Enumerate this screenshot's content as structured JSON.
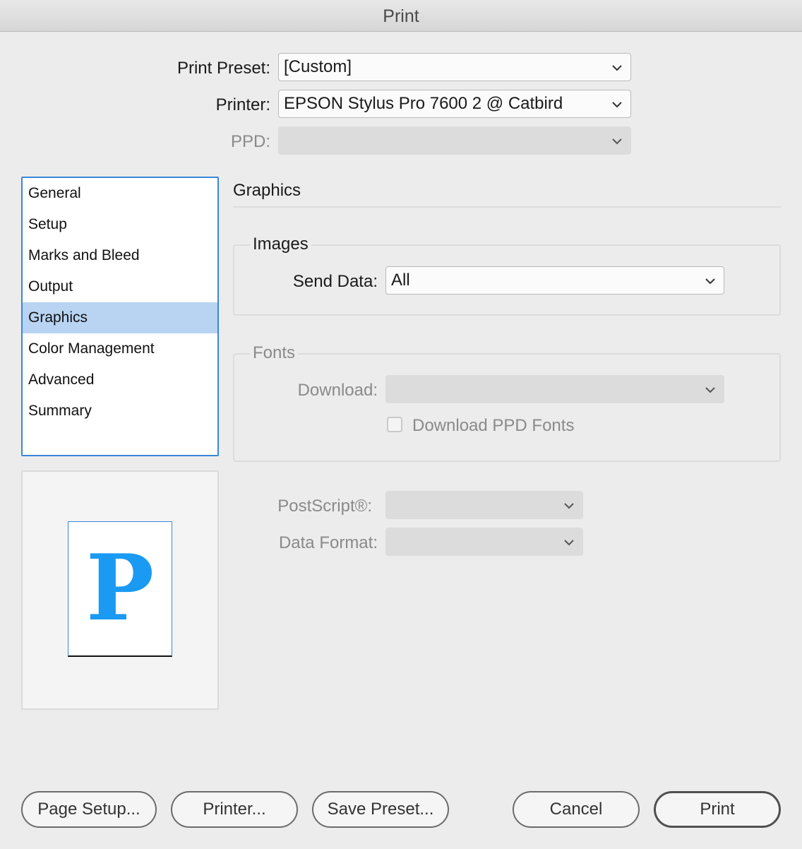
{
  "window": {
    "title": "Print"
  },
  "header": {
    "preset_label": "Print Preset:",
    "preset_value": "[Custom]",
    "printer_label": "Printer:",
    "printer_value": "EPSON Stylus Pro 7600 2 @ Catbird",
    "ppd_label": "PPD:",
    "ppd_value": ""
  },
  "sidebar": {
    "items": [
      {
        "label": "General"
      },
      {
        "label": "Setup"
      },
      {
        "label": "Marks and Bleed"
      },
      {
        "label": "Output"
      },
      {
        "label": "Graphics",
        "selected": true
      },
      {
        "label": "Color Management"
      },
      {
        "label": "Advanced"
      },
      {
        "label": "Summary"
      }
    ]
  },
  "preview": {
    "glyph": "P",
    "glyph_color": "#1a9af2"
  },
  "main": {
    "section_title": "Graphics",
    "images": {
      "title": "Images",
      "send_data_label": "Send Data:",
      "send_data_value": "All"
    },
    "fonts": {
      "title": "Fonts",
      "download_label": "Download:",
      "download_value": "",
      "ppd_fonts_label": "Download PPD Fonts",
      "ppd_fonts_checked": false
    },
    "postscript_label": "PostScript®:",
    "postscript_value": "",
    "data_format_label": "Data Format:",
    "data_format_value": ""
  },
  "footer": {
    "page_setup": "Page Setup...",
    "printer": "Printer...",
    "save_preset": "Save Preset...",
    "cancel": "Cancel",
    "print": "Print"
  },
  "colors": {
    "accent": "#3b86d9",
    "selection": "#b8d4f2",
    "background": "#ececec"
  }
}
